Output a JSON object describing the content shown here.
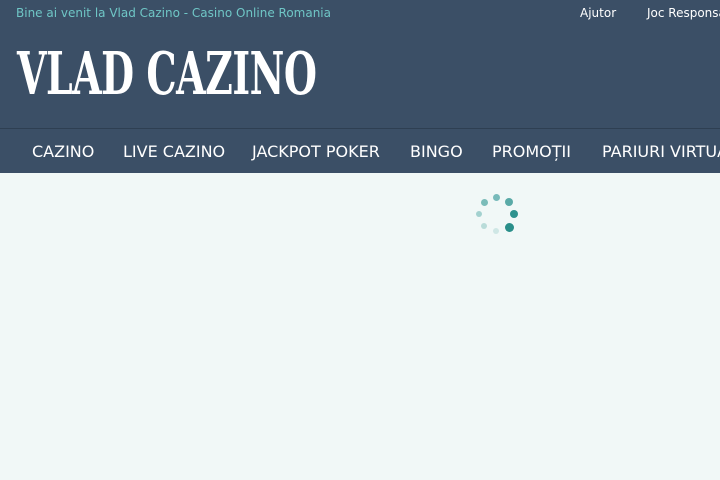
{
  "topbar": {
    "welcome": "Bine ai venit la Vlad Cazino - Casino Online Romania",
    "links": [
      "Ajutor",
      "Joc Responsabil"
    ]
  },
  "logo": {
    "text": "VLAD CAZINO"
  },
  "nav": {
    "items": [
      "CAZINO",
      "LIVE CAZINO",
      "JACKPOT POKER",
      "BINGO",
      "PROMOȚII",
      "PARIURI VIRTUALE"
    ]
  },
  "colors": {
    "header_bg": "#3b4f66",
    "accent": "#6fc6c6",
    "content_bg": "#f1f8f7",
    "spinner": "#2a8f8a"
  },
  "icons": {
    "loading": "loading-spinner-icon"
  }
}
